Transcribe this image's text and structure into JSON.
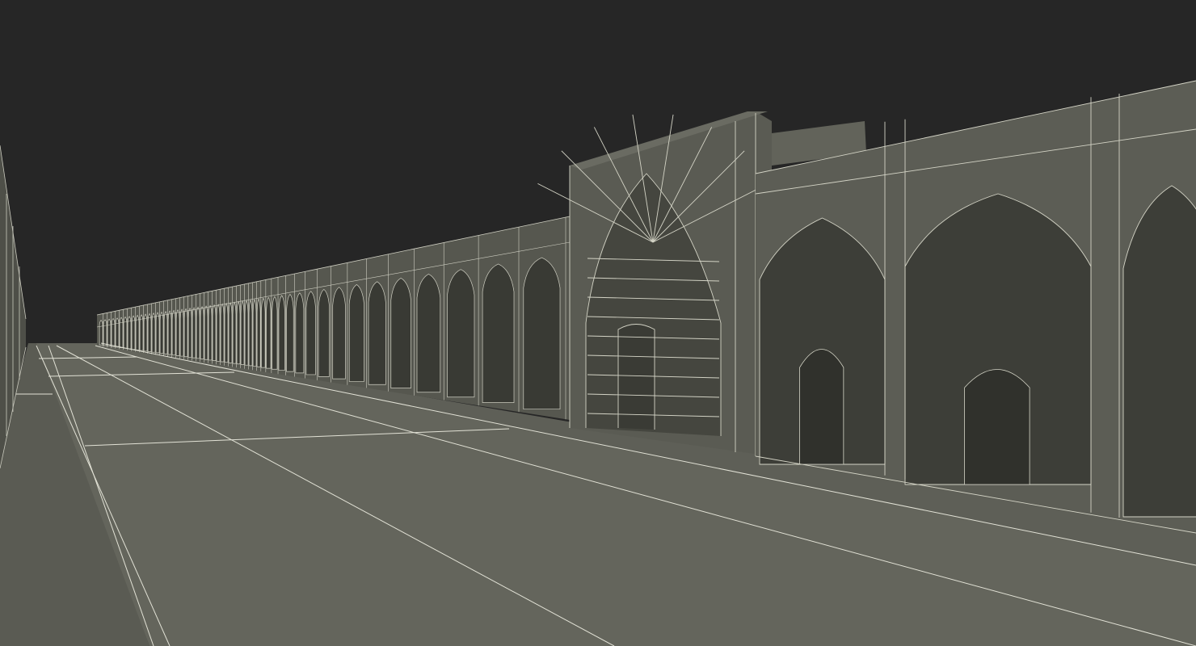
{
  "scene": {
    "subject": "arcade-wireframe-render",
    "colors": {
      "sky": "#262626",
      "ground": "#64655c",
      "facade": "#5c5d55",
      "facade_dark": "#4a4b44",
      "arch_recess": "#3d3e38",
      "arch_deep": "#31322d",
      "sidewalk": "#5e5f57",
      "wire": "#d8d8cc"
    }
  }
}
